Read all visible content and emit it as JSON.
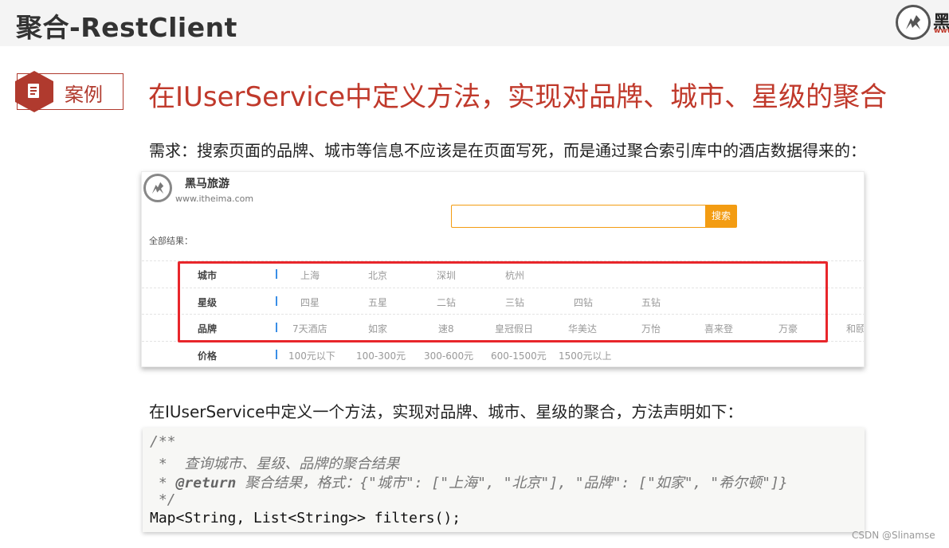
{
  "header": {
    "title": "聚合-RestClient",
    "brand_text": "黑马",
    "brand_url": "www."
  },
  "case": {
    "badge_label": "案例",
    "heading": "在IUserService中定义方法，实现对品牌、城市、星级的聚合"
  },
  "requirement": "需求：搜索页面的品牌、城市等信息不应该是在页面写死，而是通过聚合索引库中的酒店数据得来的：",
  "mock_page": {
    "site_name": "黑马旅游",
    "site_url": "www.itheima.com",
    "search_placeholder": "",
    "search_button": "搜索",
    "all_results": "全部结果：",
    "filters": [
      {
        "label": "城市",
        "options": [
          "上海",
          "北京",
          "深圳",
          "杭州"
        ]
      },
      {
        "label": "星级",
        "options": [
          "四星",
          "五星",
          "二钻",
          "三钻",
          "四钻",
          "五钻"
        ]
      },
      {
        "label": "品牌",
        "options": [
          "7天酒店",
          "如家",
          "速8",
          "皇冠假日",
          "华美达",
          "万怡",
          "喜来登",
          "万豪",
          "和颐"
        ]
      },
      {
        "label": "价格",
        "options": [
          "100元以下",
          "100-300元",
          "300-600元",
          "600-1500元",
          "1500元以上"
        ]
      }
    ]
  },
  "method_text": "在IUserService中定义一个方法，实现对品牌、城市、星级的聚合，方法声明如下：",
  "code": {
    "line1": "/**",
    "line2": " *  查询城市、星级、品牌的聚合结果",
    "line3_tag": "@return",
    "line3_prefix": " * ",
    "line3_rest": " 聚合结果，格式：{\"城市\": [\"上海\", \"北京\"], \"品牌\": [\"如家\", \"希尔顿\"]}",
    "line4": " */",
    "line5": "Map<String, List<String>> filters();"
  },
  "watermark": "CSDN @Slinamse",
  "colors": {
    "accent_red": "#c0392b",
    "highlight_red": "#e8262b",
    "search_orange": "#f39c12"
  }
}
